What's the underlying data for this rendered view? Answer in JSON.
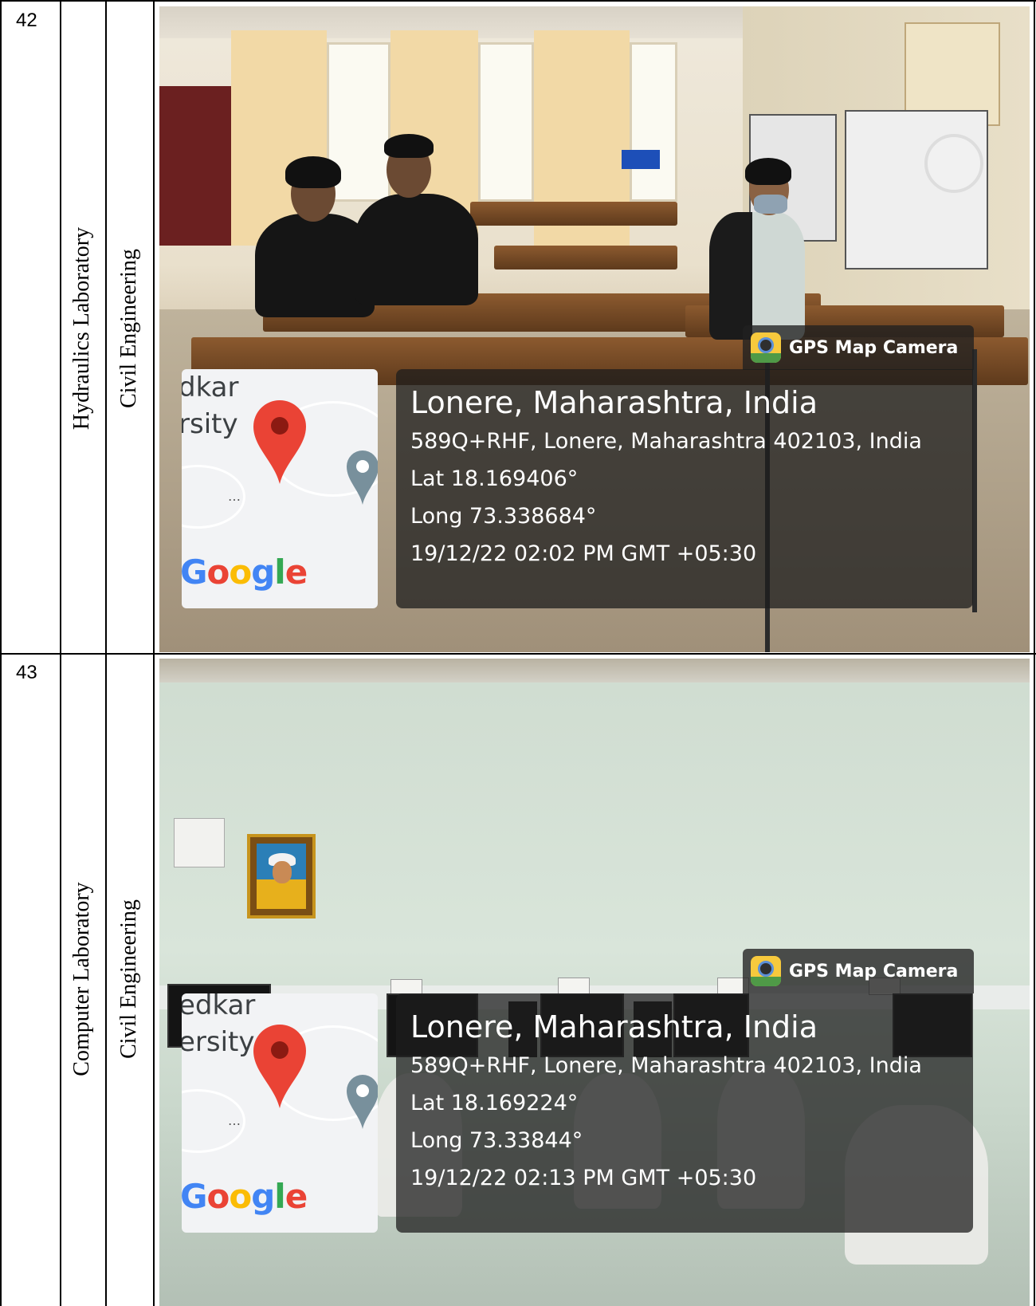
{
  "rows": [
    {
      "sno": "42",
      "lab_name": "Hydraulics Laboratory",
      "department": "Civil Engineering",
      "photo": {
        "app_label": "GPS Map Camera",
        "place": "Lonere, Maharashtra, India",
        "address": "589Q+RHF, Lonere, Maharashtra 402103, India",
        "lat": "Lat 18.169406°",
        "long": "Long 73.338684°",
        "datetime": "19/12/22 02:02 PM GMT +05:30",
        "map_text_1": "dkar",
        "map_text_2": "rsity",
        "map_brand": "Google"
      }
    },
    {
      "sno": "43",
      "lab_name": "Computer Laboratory",
      "department": "Civil Engineering",
      "photo": {
        "app_label": "GPS Map Camera",
        "place": "Lonere, Maharashtra, India",
        "address": "589Q+RHF, Lonere, Maharashtra 402103, India",
        "lat": "Lat 18.169224°",
        "long": "Long 73.33844°",
        "datetime": "19/12/22 02:13 PM GMT +05:30",
        "map_text_1": "edkar",
        "map_text_2": "ersity",
        "map_brand": "Google"
      }
    }
  ],
  "colors": {
    "google_blue": "#4285F4",
    "google_red": "#EA4335",
    "google_yellow": "#FBBC05",
    "google_green": "#34A853",
    "pin_red": "#EA4335"
  }
}
